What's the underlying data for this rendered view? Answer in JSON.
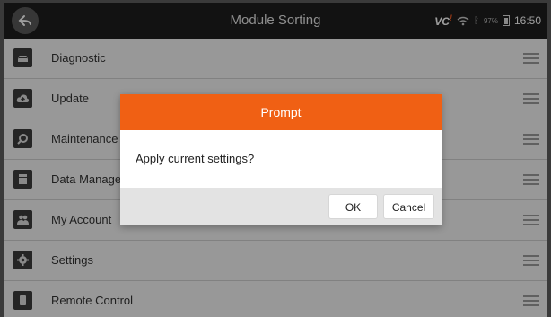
{
  "header": {
    "title": "Module Sorting"
  },
  "status": {
    "vci": "VC",
    "battery_pct": "97%",
    "time": "16:50"
  },
  "list": {
    "items": [
      {
        "label": "Diagnostic",
        "icon": "car-icon"
      },
      {
        "label": "Update",
        "icon": "cloud-upload-icon"
      },
      {
        "label": "Maintenance",
        "icon": "wrench-gear-icon"
      },
      {
        "label": "Data Manage",
        "icon": "database-icon"
      },
      {
        "label": "My Account",
        "icon": "users-icon"
      },
      {
        "label": "Settings",
        "icon": "gear-icon"
      },
      {
        "label": "Remote Control",
        "icon": "remote-icon"
      }
    ]
  },
  "dialog": {
    "title": "Prompt",
    "message": "Apply current settings?",
    "ok_label": "OK",
    "cancel_label": "Cancel"
  },
  "colors": {
    "accent": "#f06014",
    "topbar": "#1e1e1e"
  }
}
